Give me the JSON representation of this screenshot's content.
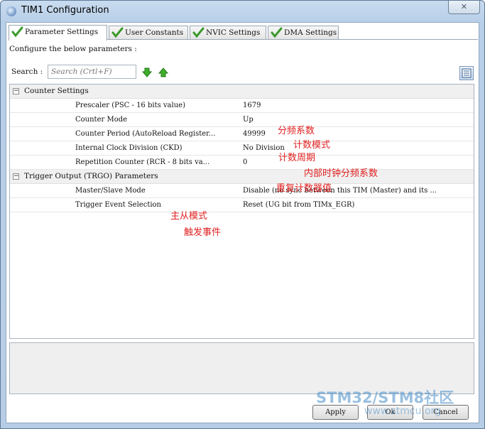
{
  "window": {
    "title": "TIM1 Configuration",
    "close_glyph": "✕"
  },
  "tabs": [
    {
      "label": "Parameter Settings",
      "active": true
    },
    {
      "label": "User Constants",
      "active": false
    },
    {
      "label": "NVIC Settings",
      "active": false
    },
    {
      "label": "DMA Settings",
      "active": false
    }
  ],
  "configure_label": "Configure the below parameters :",
  "search": {
    "label": "Search :",
    "placeholder": "Search (Crtl+F)"
  },
  "groups": [
    {
      "label": "Counter Settings",
      "expander": "−",
      "params": [
        {
          "name": "Prescaler (PSC - 16 bits value)",
          "value": "1679"
        },
        {
          "name": "Counter Mode",
          "value": "Up"
        },
        {
          "name": "Counter Period (AutoReload Register...",
          "value": "49999"
        },
        {
          "name": "Internal Clock Division (CKD)",
          "value": "No Division"
        },
        {
          "name": "Repetition Counter (RCR - 8 bits va...",
          "value": "0"
        }
      ]
    },
    {
      "label": "Trigger Output (TRGO) Parameters",
      "expander": "−",
      "params": [
        {
          "name": "Master/Slave Mode",
          "value": "Disable (no sync between this TIM (Master) and its ..."
        },
        {
          "name": "Trigger Event Selection",
          "value": "Reset (UG bit from TIMx_EGR)"
        }
      ]
    }
  ],
  "annotations": [
    "分频系数",
    "计数模式",
    "计数周期",
    "内部时钟分频系数",
    "重复计数器值",
    "主从模式",
    "触发事件"
  ],
  "buttons": {
    "apply": "Apply",
    "ok": "Ok",
    "cancel": "Cancel"
  },
  "watermark": {
    "line1": "STM32/STM8社区",
    "line2": "www.stmcu.org"
  },
  "colors": {
    "accent": "#3a9a2a",
    "annotation": "#e02020",
    "titlebar": "#c9dcef"
  },
  "icons": {
    "tab_check": "check-icon",
    "arrow_down": "arrow-down-icon",
    "arrow_up": "arrow-up-icon",
    "view_toggle": "list-view-icon"
  }
}
